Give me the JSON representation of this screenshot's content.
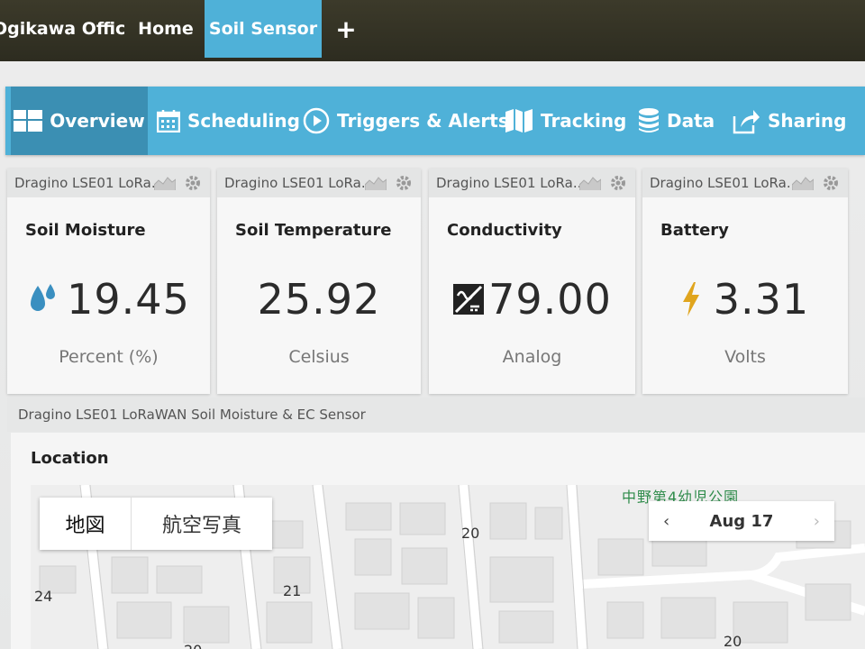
{
  "top_tabs": [
    {
      "label": "Ogikawa Office"
    },
    {
      "label": "Home"
    },
    {
      "label": "Soil Sensor"
    },
    {
      "label": "+"
    }
  ],
  "nav": [
    {
      "label": "Overview",
      "icon": "dashboard-icon"
    },
    {
      "label": "Scheduling",
      "icon": "calendar-icon"
    },
    {
      "label": "Triggers & Alerts",
      "icon": "play-circle-icon"
    },
    {
      "label": "Tracking",
      "icon": "map-icon"
    },
    {
      "label": "Data",
      "icon": "database-icon"
    },
    {
      "label": "Sharing",
      "icon": "share-icon"
    }
  ],
  "widgets": [
    {
      "device": "Dragino LSE01 LoRa..",
      "title": "Soil Moisture",
      "value": "19.45",
      "unit": "Percent (%)",
      "icon": "water-drop-icon",
      "icon_color": "#3a8fc0"
    },
    {
      "device": "Dragino LSE01 LoRa..",
      "title": "Soil Temperature",
      "value": "25.92",
      "unit": "Celsius",
      "icon": "",
      "icon_color": ""
    },
    {
      "device": "Dragino LSE01 LoRa..",
      "title": "Conductivity",
      "value": "79.00",
      "unit": "Analog",
      "icon": "analog-icon",
      "icon_color": "#222222"
    },
    {
      "device": "Dragino LSE01 LoRa..",
      "title": "Battery",
      "value": "3.31",
      "unit": "Volts",
      "icon": "lightning-icon",
      "icon_color": "#e0a51e"
    }
  ],
  "location_section": {
    "device": "Dragino LSE01 LoRaWAN Soil Moisture & EC Sensor",
    "title": "Location"
  },
  "map": {
    "type_buttons": [
      "地図",
      "航空写真"
    ],
    "date": "Aug 17",
    "park_label": "中野第4幼児公園",
    "block_numbers": [
      "20",
      "24",
      "21",
      "20",
      "20"
    ]
  },
  "colors": {
    "accent": "#4fb1d8",
    "accent_dark": "#3b8fb3",
    "topbar": "#34331f"
  }
}
